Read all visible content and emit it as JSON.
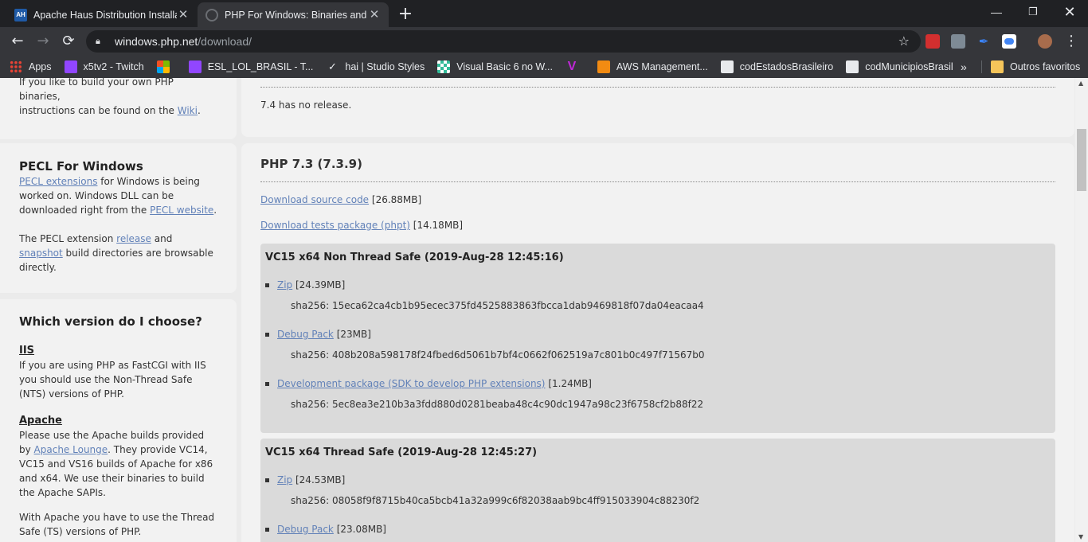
{
  "browser": {
    "tabs": [
      {
        "title": "Apache Haus Distribution Installa",
        "favicon": "AH",
        "active": false
      },
      {
        "title": "PHP For Windows: Binaries and s",
        "active": true
      }
    ],
    "new_tab_icon": "+",
    "window_controls": {
      "minimize": "—",
      "maximize": "❐",
      "close": "✕"
    },
    "nav": {
      "back": "←",
      "forward": "→",
      "reload": "⟳"
    },
    "url_host": "windows.php.net",
    "url_path": "/download/",
    "bookmarks": [
      {
        "label": "Apps",
        "icon": "apps-grid-icon"
      },
      {
        "label": "x5tv2 - Twitch",
        "icon": "twitch-icon"
      },
      {
        "label": "",
        "icon": "microsoft-icon"
      },
      {
        "label": "ESL_LOL_BRASIL - T...",
        "icon": "twitch-icon"
      },
      {
        "label": "hai | Studio Styles",
        "icon": "hai-icon"
      },
      {
        "label": "Visual Basic 6 no W...",
        "icon": "vb-icon"
      },
      {
        "label": "",
        "icon": "v-icon"
      },
      {
        "label": "AWS Management...",
        "icon": "aws-icon"
      },
      {
        "label": "codEstadosBrasileiro",
        "icon": "github-icon"
      },
      {
        "label": "codMunicipiosBrasil",
        "icon": "github-icon"
      }
    ],
    "bookmarks_more": "»",
    "other_bookmarks": "Outros favoritos"
  },
  "sidebar": {
    "build_text_1": "If you like to build your own PHP binaries,",
    "build_text_2": "instructions can be found on the ",
    "build_link": "Wiki",
    "build_text_end": ".",
    "pecl": {
      "title": "PECL For Windows",
      "link1": "PECL extensions",
      "text1": " for Windows is being worked on. Windows DLL can be downloaded right from the ",
      "link2": "PECL website",
      "text2": ".",
      "text3": "The PECL extension ",
      "link3": "release",
      "text4": " and ",
      "link4": "snapshot",
      "text5": " build directories are browsable directly."
    },
    "which": {
      "title": "Which version do I choose?",
      "iis_heading": "IIS",
      "iis_text": "If you are using PHP as FastCGI with IIS you should use the Non-Thread Safe (NTS) versions of PHP.",
      "apache_heading": "Apache",
      "apache_text1": "Please use the Apache builds provided by ",
      "apache_link": "Apache Lounge",
      "apache_text2": ". They provide VC14, VC15 and VS16 builds of Apache for x86 and x64. We use their binaries to build the Apache SAPIs.",
      "apache_text3": "With Apache you have to use the Thread Safe (TS) versions of PHP."
    }
  },
  "main": {
    "no_release": "7.4 has no release.",
    "php73": {
      "title": "PHP 7.3 (7.3.9)",
      "source_link": "Download source code",
      "source_size": " [26.88MB]",
      "tests_link": "Download tests package (phpt)",
      "tests_size": " [14.18MB]",
      "builds": [
        {
          "title": "VC15 x64 Non Thread Safe (2019-Aug-28 12:45:16)",
          "items": [
            {
              "link": "Zip",
              "size": " [24.39MB]",
              "sha": "sha256: 15eca62ca4cb1b95ecec375fd4525883863fbcca1dab9469818f07da04eacaa4"
            },
            {
              "link": "Debug Pack",
              "size": " [23MB]",
              "sha": "sha256: 408b208a598178f24fbed6d5061b7bf4c0662f062519a7c801b0c497f71567b0"
            },
            {
              "link": "Development package (SDK to develop PHP extensions)",
              "size": " [1.24MB]",
              "sha": "sha256: 5ec8ea3e210b3a3fdd880d0281beaba48c4c90dc1947a98c23f6758cf2b88f22"
            }
          ]
        },
        {
          "title": "VC15 x64 Thread Safe (2019-Aug-28 12:45:27)",
          "items": [
            {
              "link": "Zip",
              "size": " [24.53MB]",
              "sha": "sha256: 08058f9f8715b40ca5bcb41a32a999c6f82038aab9bc4ff915033904c88230f2"
            },
            {
              "link": "Debug Pack",
              "size": " [23.08MB]",
              "sha": ""
            }
          ]
        }
      ]
    }
  },
  "colors": {
    "link": "#6181b8",
    "card": "#f2f2f2",
    "page_bg": "#ebebeb",
    "build_bg": "#dadada"
  }
}
